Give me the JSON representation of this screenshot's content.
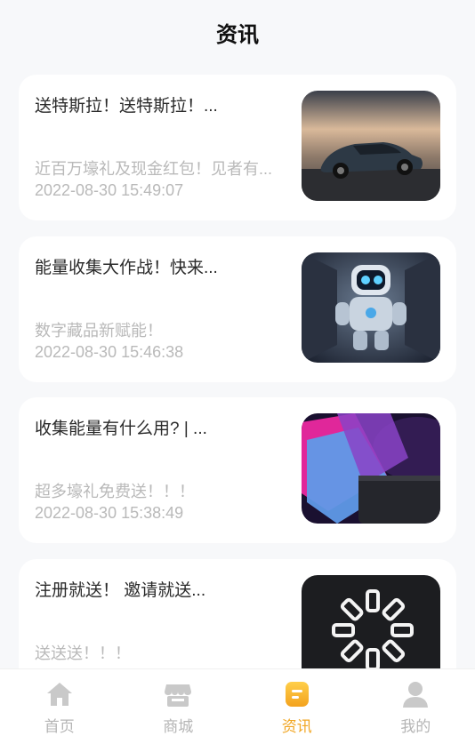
{
  "header": {
    "title": "资讯"
  },
  "articles": [
    {
      "title": "送特斯拉！送特斯拉！...",
      "summary": "近百万壕礼及现金红包！见者有...",
      "date": "2022-08-30 15:49:07",
      "image": "tesla-car"
    },
    {
      "title": "能量收集大作战！快来...",
      "summary": "数字藏品新赋能！",
      "date": "2022-08-30 15:46:38",
      "image": "robot"
    },
    {
      "title": "收集能量有什么用? | ...",
      "summary": "超多壕礼免费送！！！",
      "date": "2022-08-30 15:38:49",
      "image": "game-cards"
    },
    {
      "title": "注册就送！ 邀请就送...",
      "summary": "送送送！！！",
      "date": "",
      "image": "neon-ring"
    }
  ],
  "tabbar": {
    "tabs": [
      {
        "label": "首页",
        "icon": "home-icon"
      },
      {
        "label": "商城",
        "icon": "store-icon"
      },
      {
        "label": "资讯",
        "icon": "news-icon",
        "active": true
      },
      {
        "label": "我的",
        "icon": "user-icon"
      }
    ]
  },
  "colors": {
    "accent": "#f1a623",
    "inactive": "#b5b5b5",
    "background": "#f7f8fa"
  }
}
